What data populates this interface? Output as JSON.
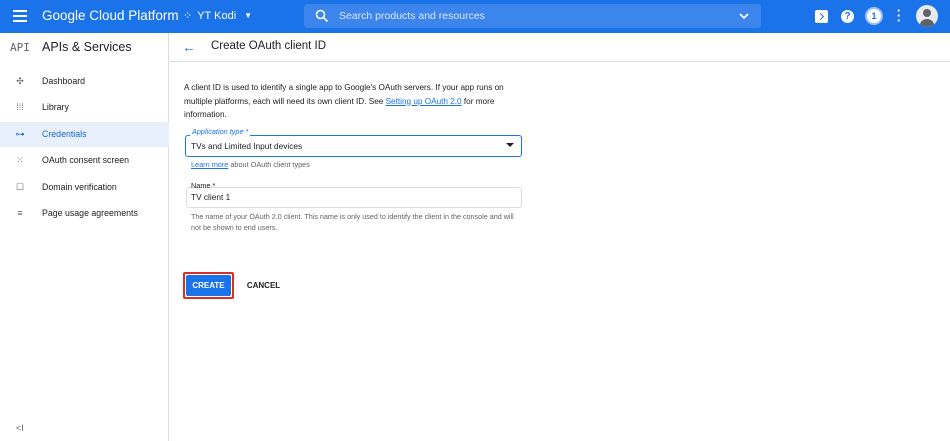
{
  "topbar": {
    "brand": "Google Cloud Platform",
    "project": "YT Kodi",
    "search_placeholder": "Search products and resources",
    "notification_count": "1",
    "accent": "#1a73e8"
  },
  "sidebar": {
    "logo": "API",
    "title": "APIs & Services",
    "items": [
      {
        "label": "Dashboard",
        "icon": "dashboard-icon"
      },
      {
        "label": "Library",
        "icon": "library-icon"
      },
      {
        "label": "Credentials",
        "icon": "key-icon",
        "active": true
      },
      {
        "label": "OAuth consent screen",
        "icon": "consent-icon"
      },
      {
        "label": "Domain verification",
        "icon": "domain-icon"
      },
      {
        "label": "Page usage agreements",
        "icon": "settings-list-icon"
      }
    ],
    "collapse_label": "<I"
  },
  "header": {
    "back_label": "←",
    "title": "Create OAuth client ID"
  },
  "form": {
    "description_pre": "A client ID is used to identify a single app to Google's OAuth servers. If your app runs on multiple platforms, each will need its own client ID. See ",
    "description_link": "Setting up OAuth 2.0",
    "description_post": " for more information.",
    "app_type_label": "Application type *",
    "app_type_value": "TVs and Limited Input devices",
    "learn_more_link": "Learn more",
    "learn_more_rest": " about OAuth client types",
    "name_label": "Name *",
    "name_value": "TV client 1",
    "name_hint": "The name of your OAuth 2.0 client. This name is only used to identify the client in the console and will not be shown to end users.",
    "create_label": "CREATE",
    "cancel_label": "CANCEL"
  }
}
